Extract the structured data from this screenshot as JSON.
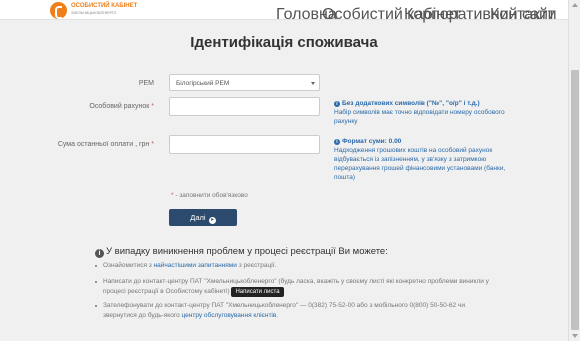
{
  "header": {
    "logo_line1": "ОСОБИСТИЙ КАБІНЕТ",
    "logo_line2": "ХМЕЛЬНИЦЬКОБЛЕНЕРГО",
    "nav": [
      "Головна",
      "Особистий кабінет",
      "Корпоративний сайт",
      "Контакти"
    ]
  },
  "page": {
    "title": "Ідентифікація споживача"
  },
  "form": {
    "rem_label": "РЕМ",
    "rem_value": "Білогірський РЕМ",
    "account_label": "Особовий рахунок",
    "account_value": "",
    "sum_label": "Сума останньої оплати , грн",
    "sum_value": "",
    "required_mark": "*",
    "required_note": "- заповнити обов'язково",
    "next_button": "Далі"
  },
  "help": {
    "account_title": "Без додаткових символів (\"№\", \"о/р\" і т.д.)",
    "account_text": "Набір символів має точно відповідати номеру особового рахунку",
    "sum_title": "Формат суми: 0.00",
    "sum_text": "Надходження грошових коштів на особовий рахунок відбувається із запізненням, у зв'язку з затримкою перерахування грошей фінансовими установами (банки, пошта)"
  },
  "problems": {
    "title": "У випадку виникнення проблем у процесі реєстрації Ви можете:",
    "item1_pre": "Ознайомитися з ",
    "item1_link": "найчастішими запитаннями",
    "item1_post": " з реєстрації.",
    "item2_text": "Написати до контакт-центру ПАТ \"Хмельницькобленерго\" (будь ласка, вкажіть у своєму листі які конкретно проблеми виникли у процесі реєстрації в Особистому кабінеті)",
    "item2_button": "Написати листа",
    "item3_text": "Зателефонувати до контакт-центру ПАТ \"Хмельницькобленерго\" — 0(382) 75-52-00 або з мобільного 0(800) 50-50-62 чи звернутися до будь-якого ",
    "item3_link": "центру обслуговування клієнтів",
    "item3_post": "."
  },
  "icons": {
    "logo": "logo-icon",
    "info": "info-icon",
    "arrow": "arrow-right-circle-icon",
    "caret": "chevron-down-icon"
  },
  "colors": {
    "brand": "#f07f1a",
    "primary_button": "#2c4a6e",
    "help_text": "#2a6aa8",
    "required": "#d9534f"
  }
}
